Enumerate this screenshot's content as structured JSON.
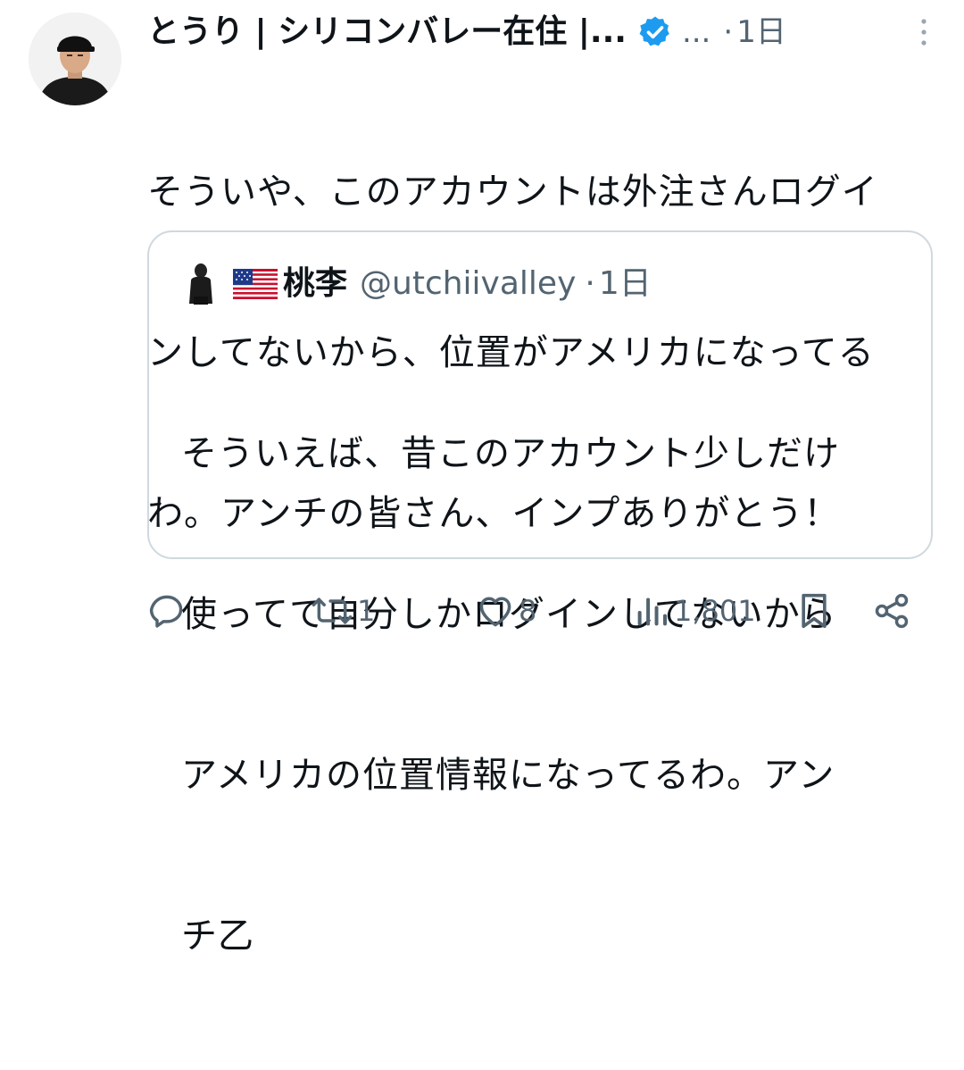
{
  "tweet": {
    "author": {
      "name": "とうり | シリコンバレー在住 |...",
      "handle_truncated": "...",
      "avatar_icon": "user-avatar-black-cap",
      "verified_icon": "verified-badge-icon"
    },
    "separator": "·",
    "time": "1日",
    "text_lines": [
      "そういや、このアカウントは外注さんログイ",
      "ンしてないから、位置がアメリカになってる",
      "わ。アンチの皆さん、インプありがとう！"
    ],
    "more_icon": "more-vertical-icon"
  },
  "quote": {
    "avatar_icon": "user-avatar-hooded-figure",
    "flag_icon": "us-flag-emoji",
    "name": "桃李",
    "handle": "@utchiivalley",
    "separator": "·",
    "time": "1日",
    "text_lines": [
      "そういえば、昔このアカウント少しだけ",
      "使ってて自分しかログインしてないから",
      "アメリカの位置情報になってるわ。アン",
      "チ乙"
    ]
  },
  "actions": {
    "reply": {
      "icon": "reply-icon",
      "count": ""
    },
    "retweet": {
      "icon": "retweet-icon",
      "count": "1"
    },
    "like": {
      "icon": "heart-icon",
      "count": "8"
    },
    "views": {
      "icon": "views-chart-icon",
      "count": "1,801"
    },
    "bookmark": {
      "icon": "bookmark-icon"
    },
    "share": {
      "icon": "share-icon"
    }
  },
  "colors": {
    "text_primary": "#0f1419",
    "text_secondary": "#536471",
    "verified_blue": "#1d9bf0",
    "border": "#cfd9de"
  }
}
